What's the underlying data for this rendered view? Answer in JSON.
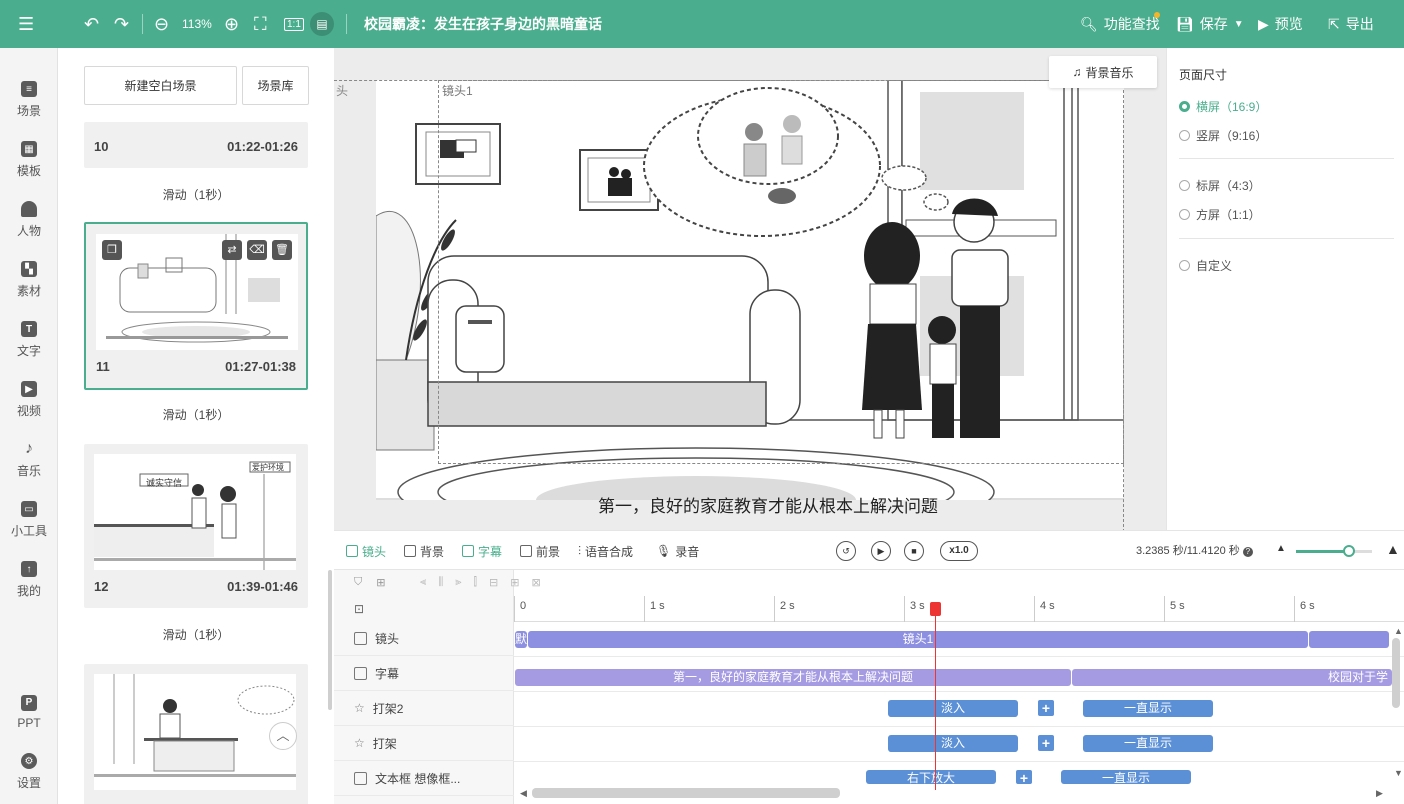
{
  "topbar": {
    "zoom": "113%",
    "title": "校园霸凌：发生在孩子身边的黑暗童话",
    "menu": [
      "功能查找",
      "保存",
      "预览",
      "导出"
    ],
    "accent_color": "#4aae8e"
  },
  "leftnav": [
    "场景",
    "模板",
    "人物",
    "素材",
    "文字",
    "视频",
    "音乐",
    "小工具",
    "我的",
    "PPT",
    "设置"
  ],
  "scene_panel": {
    "new_blank_button": "新建空白场景",
    "library_button": "场景库",
    "cards": [
      {
        "num": "10",
        "time": "01:22-01:26"
      },
      {
        "num": "11",
        "time": "01:27-01:38"
      },
      {
        "num": "12",
        "time": "01:39-01:46"
      }
    ],
    "transition": "滑动（1秒）",
    "thumb_texts": [
      "诚实守信",
      "爱护环境"
    ]
  },
  "canvas": {
    "bgm_label": "背景音乐",
    "lens_label": "镜头1",
    "lens_label_left": "头",
    "subtitle": "第一，良好的家庭教育才能从根本上解决问题"
  },
  "right_panel": {
    "title": "页面尺寸",
    "options": [
      "横屏（16:9）",
      "竖屏（9:16）",
      "标屏（4:3）",
      "方屏（1:1）",
      "自定义"
    ]
  },
  "timeline_toolbar": {
    "tabs": [
      "镜头",
      "背景",
      "字幕",
      "前景",
      "语音合成",
      "录音"
    ],
    "speed": "x1.0",
    "time_info": "3.2385 秒/11.4120 秒",
    "zoom_fraction": 0.7
  },
  "timeline": {
    "ticks": [
      "0",
      "1 s",
      "2 s",
      "3 s",
      "4 s",
      "5 s",
      "6 s"
    ],
    "tracks": [
      "镜头",
      "字幕",
      "打架2",
      "打架",
      "文本框 想像框..."
    ],
    "clips": {
      "lens_default": "默",
      "lens_main": "镜头1",
      "subtitle_1": "第一，良好的家庭教育才能从根本上解决问题",
      "subtitle_2": "校园对于学",
      "fade_in": "淡入",
      "always_show": "一直显示",
      "zoom_right_down": "右下放大",
      "plus": "+"
    }
  }
}
